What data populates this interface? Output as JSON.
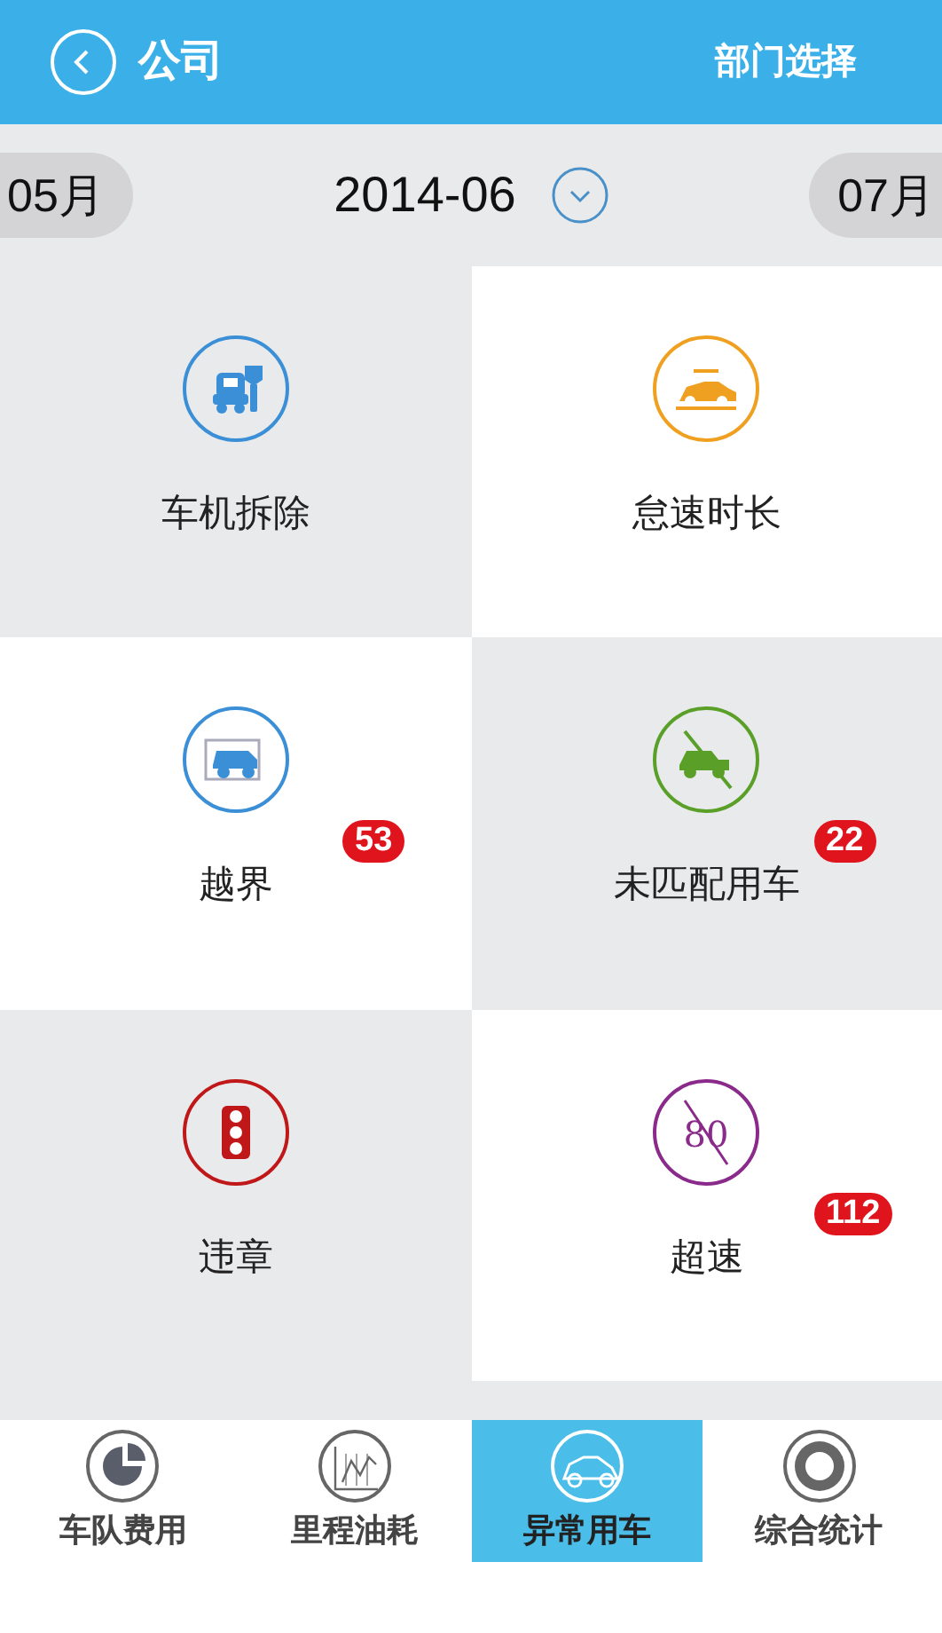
{
  "header": {
    "back_label": "公司",
    "action": "部门选择"
  },
  "month_bar": {
    "previous": "05月",
    "current": "2014-06",
    "next": "07月"
  },
  "categories": [
    {
      "label": "车机拆除",
      "kind": "tools",
      "color": "#3a8fd6"
    },
    {
      "label": "怠速时长",
      "kind": "racing-car",
      "color": "#f0a020"
    },
    {
      "label": "越界",
      "kind": "boundary",
      "color": "#3a8fd6",
      "badge": "53"
    },
    {
      "label": "未匹配用车",
      "kind": "no-car",
      "color": "#5aa028",
      "badge": "22"
    },
    {
      "label": "违章",
      "kind": "traffic-light",
      "color": "#c01818"
    },
    {
      "label": "超速",
      "kind": "speed-limit",
      "color": "#8a2a8a",
      "icon_text": "80",
      "badge": "112"
    }
  ],
  "tabs": [
    {
      "label": "车队费用",
      "kind": "pie",
      "selected": false
    },
    {
      "label": "里程油耗",
      "kind": "line",
      "selected": false
    },
    {
      "label": "异常用车",
      "kind": "car",
      "selected": true
    },
    {
      "label": "综合统计",
      "kind": "ring",
      "selected": false
    }
  ]
}
